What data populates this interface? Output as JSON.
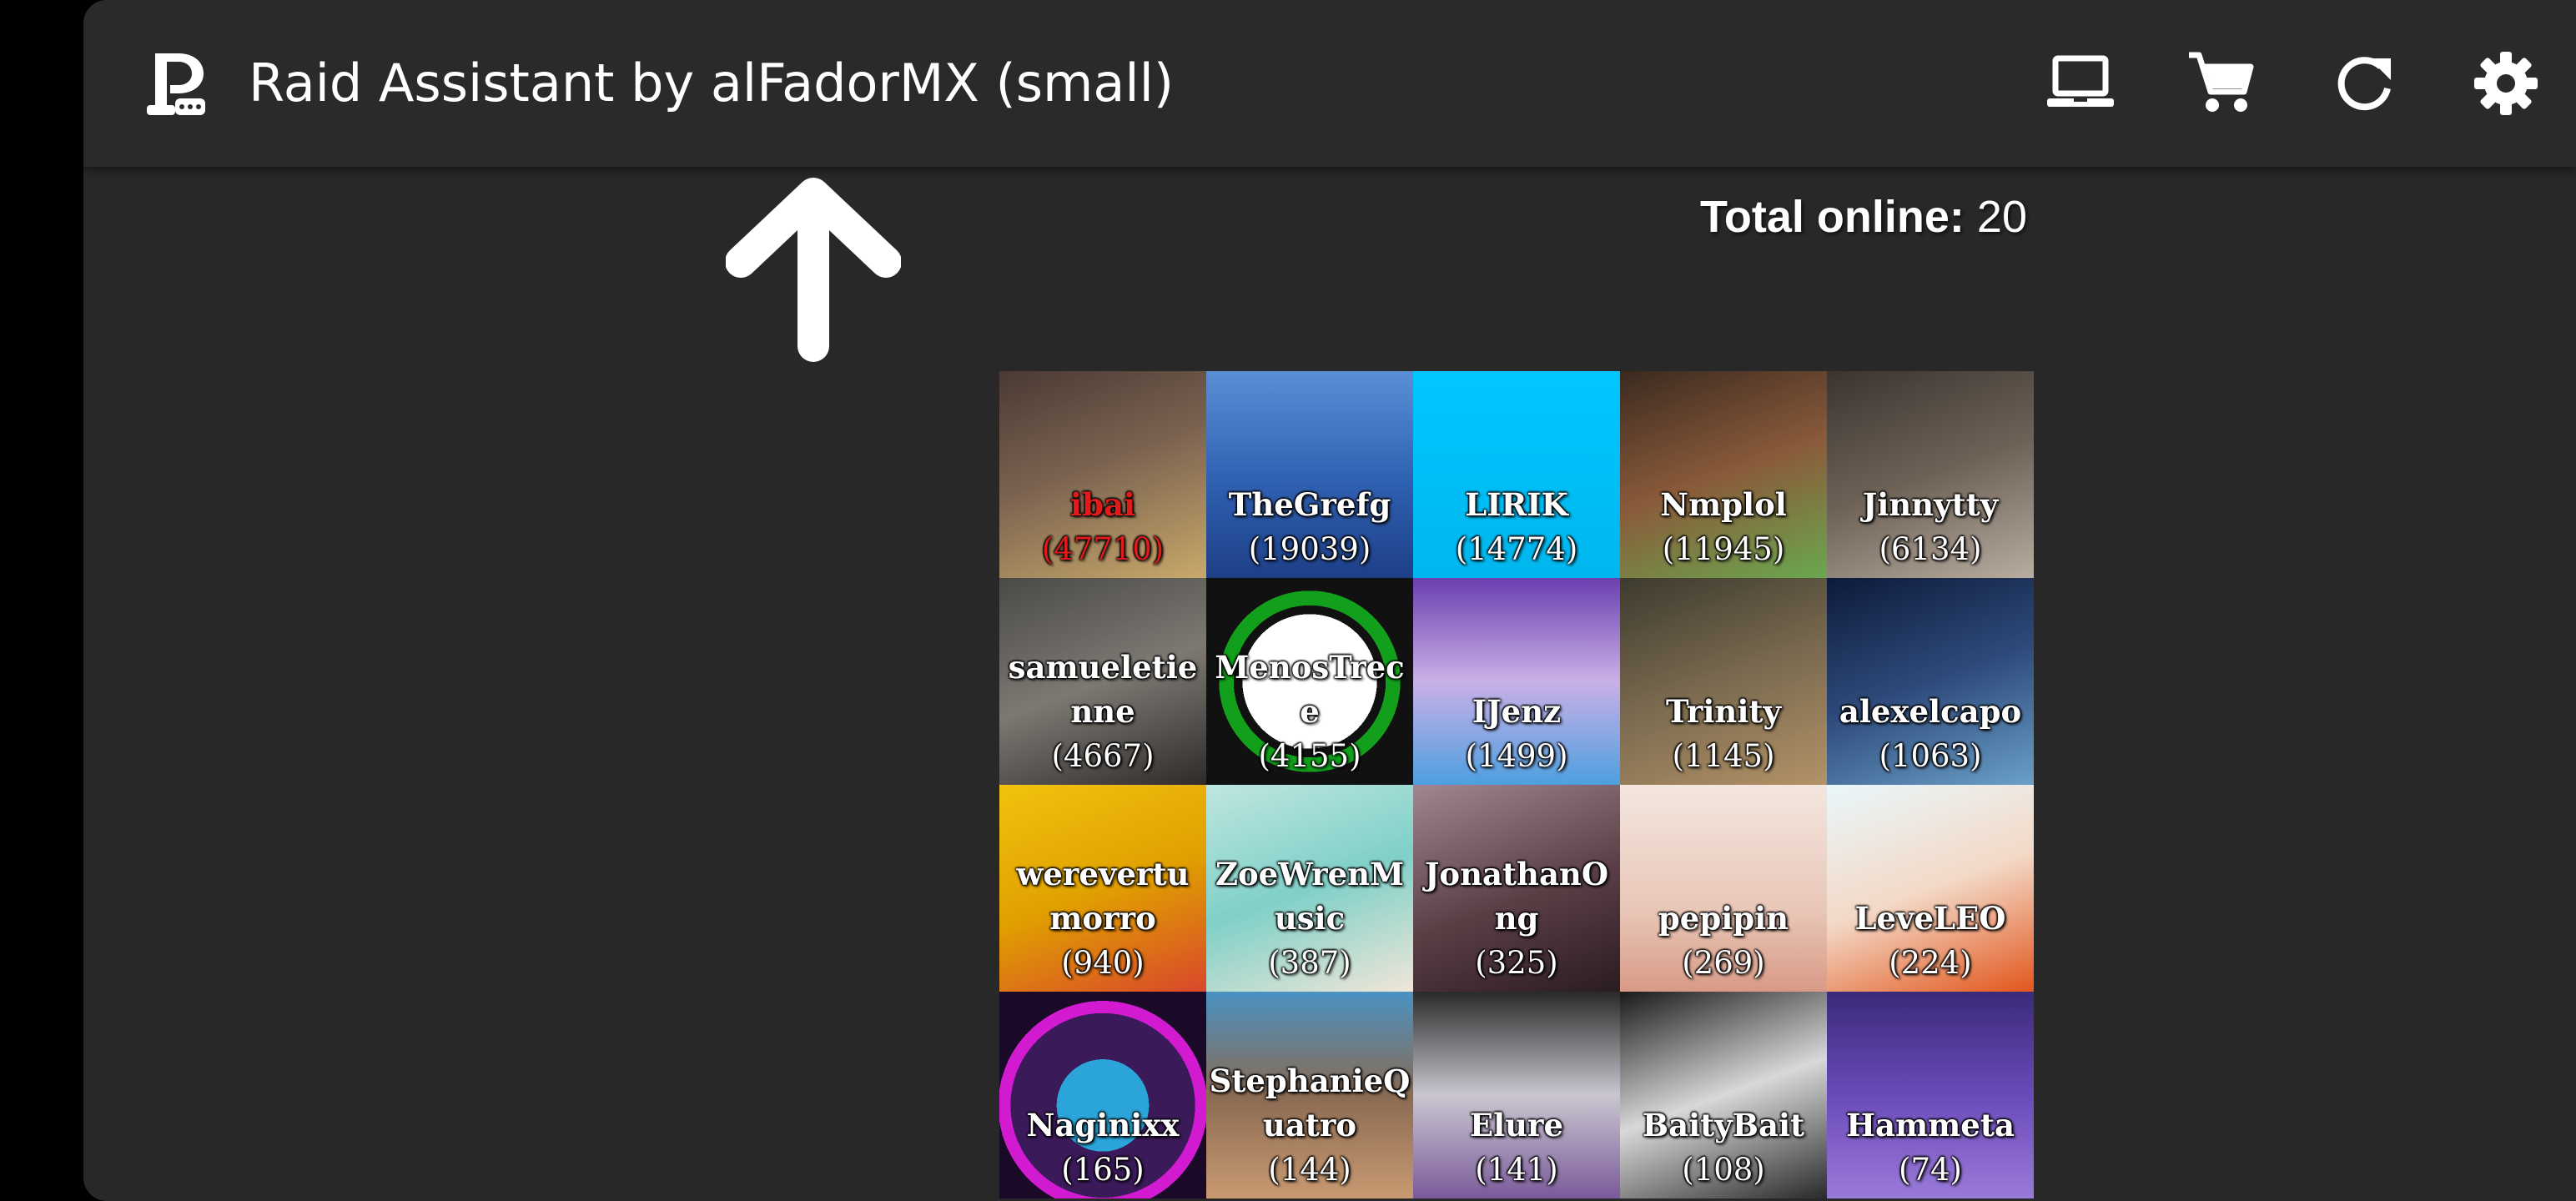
{
  "app": {
    "title": "Raid Assistant by alFadorMX (small)"
  },
  "toolbar": {
    "icons": [
      "laptop-icon",
      "shopping-cart-icon",
      "refresh-icon",
      "settings-gear-icon"
    ]
  },
  "status": {
    "total_online_label": "Total online:",
    "total_online_value": "20"
  },
  "colors": {
    "background": "#282828",
    "topbar": "#2a2a2a",
    "text": "#ffffff",
    "highlight": "#e01b1b"
  },
  "streamers": [
    {
      "name": "ibai",
      "viewers": "(47710)",
      "highlight": true
    },
    {
      "name": "TheGrefg",
      "viewers": "(19039)"
    },
    {
      "name": "LIRIK",
      "viewers": "(14774)"
    },
    {
      "name": "Nmplol",
      "viewers": "(11945)"
    },
    {
      "name": "Jinnytty",
      "viewers": "(6134)"
    },
    {
      "name": "samueletienne",
      "viewers": "(4667)"
    },
    {
      "name": "MenosTrece",
      "viewers": "(4155)"
    },
    {
      "name": "IJenz",
      "viewers": "(1499)"
    },
    {
      "name": "Trinity",
      "viewers": "(1145)"
    },
    {
      "name": "alexelcapo",
      "viewers": "(1063)"
    },
    {
      "name": "werevertumorro",
      "viewers": "(940)"
    },
    {
      "name": "ZoeWrenMusic",
      "viewers": "(387)"
    },
    {
      "name": "JonathanOng",
      "viewers": "(325)"
    },
    {
      "name": "pepipin",
      "viewers": "(269)"
    },
    {
      "name": "LeveLEO",
      "viewers": "(224)"
    },
    {
      "name": "Naginixx",
      "viewers": "(165)"
    },
    {
      "name": "StephanieQuatro",
      "viewers": "(144)"
    },
    {
      "name": "Elure",
      "viewers": "(141)"
    },
    {
      "name": "BaityBait",
      "viewers": "(108)"
    },
    {
      "name": "Hammeta",
      "viewers": "(74)"
    }
  ]
}
